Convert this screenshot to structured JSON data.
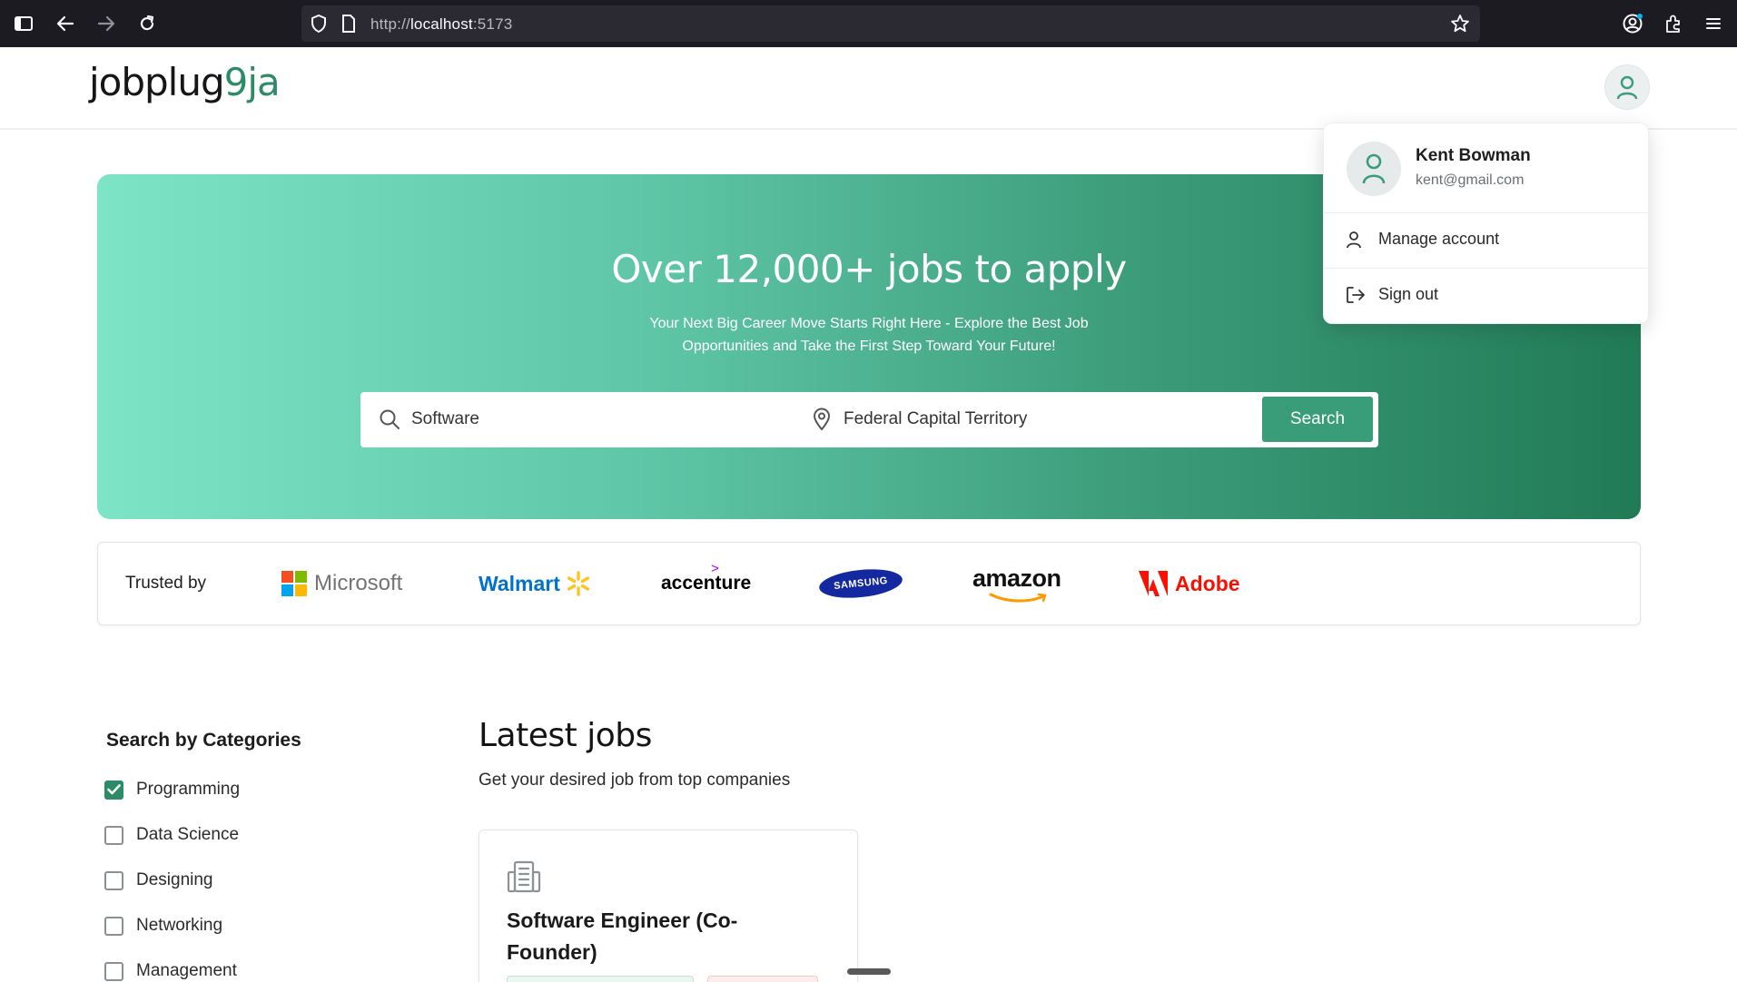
{
  "browser": {
    "url_scheme": "http://",
    "url_host": "localhost",
    "url_port": ":5173"
  },
  "header": {
    "logo_main": "jobplug",
    "logo_accent": "9ja"
  },
  "hero": {
    "title": "Over 12,000+ jobs to apply",
    "subtitle": "Your Next Big Career Move Starts Right Here - Explore the Best Job Opportunities and Take the First Step Toward Your Future!",
    "search_value": "Software",
    "location_value": "Federal Capital Territory",
    "search_button": "Search"
  },
  "trusted": {
    "label": "Trusted by",
    "brands": [
      "Microsoft",
      "Walmart",
      "accenture",
      "SAMSUNG",
      "amazon",
      "Adobe"
    ]
  },
  "account_menu": {
    "name": "Kent Bowman",
    "email": "kent@gmail.com",
    "items": [
      {
        "label": "Manage account",
        "icon": "user-icon"
      },
      {
        "label": "Sign out",
        "icon": "sign-out-icon"
      }
    ]
  },
  "categories": {
    "title": "Search by Categories",
    "items": [
      {
        "label": "Programming",
        "checked": true
      },
      {
        "label": "Data Science",
        "checked": false
      },
      {
        "label": "Designing",
        "checked": false
      },
      {
        "label": "Networking",
        "checked": false
      },
      {
        "label": "Management",
        "checked": false
      }
    ]
  },
  "jobs": {
    "title": "Latest jobs",
    "subtitle": "Get your desired job from top companies",
    "cards": [
      {
        "title": "Software Engineer (Co-Founder)",
        "icon": "company-building-icon"
      }
    ]
  },
  "colors": {
    "brand_green": "#2e8b67",
    "hero_start": "#7de4c5",
    "hero_end": "#217a56"
  }
}
